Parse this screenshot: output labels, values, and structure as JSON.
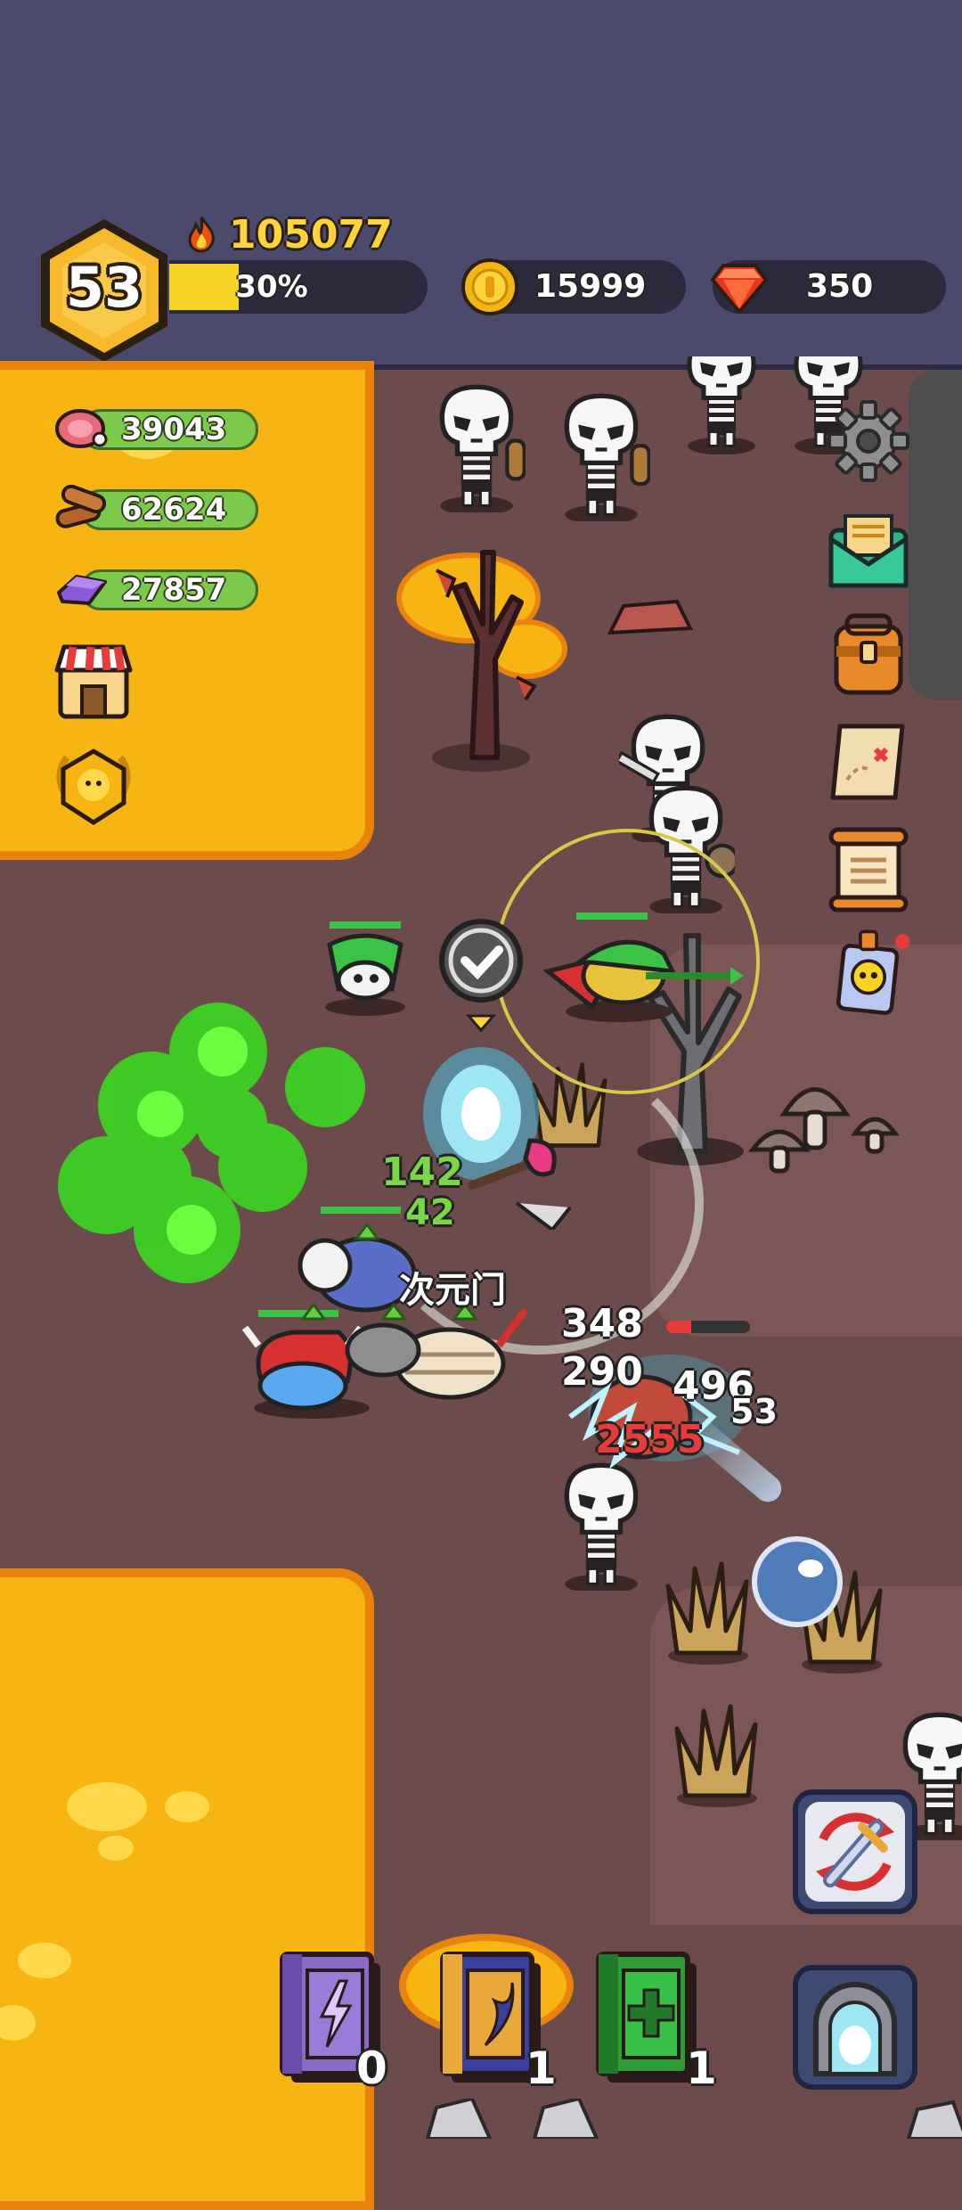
{
  "player": {
    "level": "53",
    "power": "105077",
    "xp_percent_label": "30%",
    "xp_fraction": 0.3
  },
  "currencies": {
    "gold": "15999",
    "gems": "350"
  },
  "resources": [
    {
      "name": "meat-icon",
      "value": "39043"
    },
    {
      "name": "wood-icon",
      "value": "62624"
    },
    {
      "name": "crystal-icon",
      "value": "27857"
    }
  ],
  "battle_numbers": {
    "heal_1": "142",
    "heal_2": "42",
    "hit_1": "348",
    "hit_2": "290",
    "hit_3": "496",
    "hit_4": "53",
    "crit": "2555",
    "skill_text": "次元门"
  },
  "skill_books": [
    {
      "name": "lightning-book",
      "count": "0",
      "color": "#8b69c7"
    },
    {
      "name": "wind-book",
      "count": "1",
      "color": "#3b3f9c"
    },
    {
      "name": "heal-book",
      "count": "1",
      "color": "#2f9c3a"
    }
  ],
  "colors": {
    "topbar": "#4c4a6c",
    "lava": "#f6b512",
    "ground": "#6b4b4b",
    "gold": "#ffd43b"
  }
}
